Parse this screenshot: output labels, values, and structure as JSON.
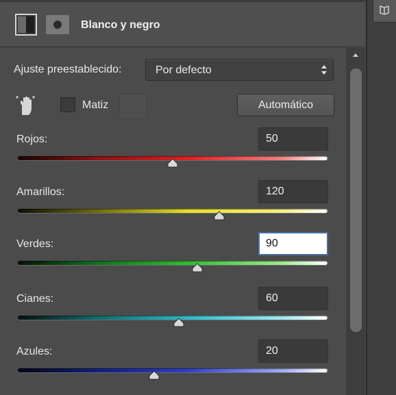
{
  "panel": {
    "title": "Blanco y negro"
  },
  "preset": {
    "label": "Ajuste preestablecido:",
    "value": "Por defecto"
  },
  "tint": {
    "label": "Matiz",
    "checked": false
  },
  "auto_button": {
    "label": "Automático"
  },
  "sliders": [
    {
      "label": "Rojos:",
      "value": "50",
      "position": 0.5,
      "colors": [
        "#1a0606",
        "#8a1212",
        "#e02020",
        "#f08080",
        "#ffffff"
      ]
    },
    {
      "label": "Amarillos:",
      "value": "120",
      "position": 0.65,
      "colors": [
        "#101006",
        "#6a6a10",
        "#e8e020",
        "#f8f080",
        "#ffffff"
      ]
    },
    {
      "label": "Verdes:",
      "value": "90",
      "position": 0.58,
      "colors": [
        "#061206",
        "#107020",
        "#30c030",
        "#a0e890",
        "#ffffff"
      ]
    },
    {
      "label": "Cianes:",
      "value": "60",
      "position": 0.52,
      "colors": [
        "#061212",
        "#106a6a",
        "#30b8c8",
        "#a0e8f0",
        "#ffffff"
      ]
    },
    {
      "label": "Azules:",
      "value": "20",
      "position": 0.44,
      "colors": [
        "#06061a",
        "#10207a",
        "#3040c8",
        "#a0a8f0",
        "#ffffff"
      ]
    }
  ],
  "icons": {
    "adjustment": "black-white-adjustment-icon",
    "mask": "layer-mask-icon",
    "hand": "targeted-adjustment-hand-icon",
    "side": "library-icon",
    "scroll_up": "scroll-up-arrow-icon"
  }
}
